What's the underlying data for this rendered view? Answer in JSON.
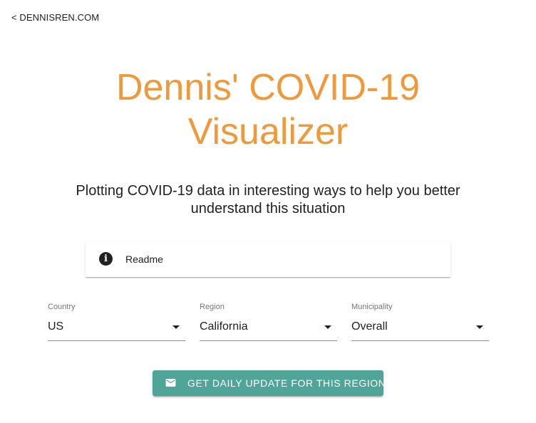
{
  "nav": {
    "back_link": "< DENNISREN.COM"
  },
  "header": {
    "title_line1": "Dennis' COVID-19",
    "title_line2": "Visualizer",
    "subtitle": "Plotting COVID-19 data in interesting ways to help you better understand this situation"
  },
  "readme": {
    "icon": "info-icon",
    "label": "Readme"
  },
  "filters": {
    "country": {
      "label": "Country",
      "value": "US"
    },
    "region": {
      "label": "Region",
      "value": "California"
    },
    "municipality": {
      "label": "Municipality",
      "value": "Overall"
    }
  },
  "cta": {
    "icon": "mail-icon",
    "label": "GET DAILY UPDATE FOR THIS REGION"
  },
  "colors": {
    "title": "#f0993b",
    "button": "#4fa597",
    "text": "#212121"
  }
}
